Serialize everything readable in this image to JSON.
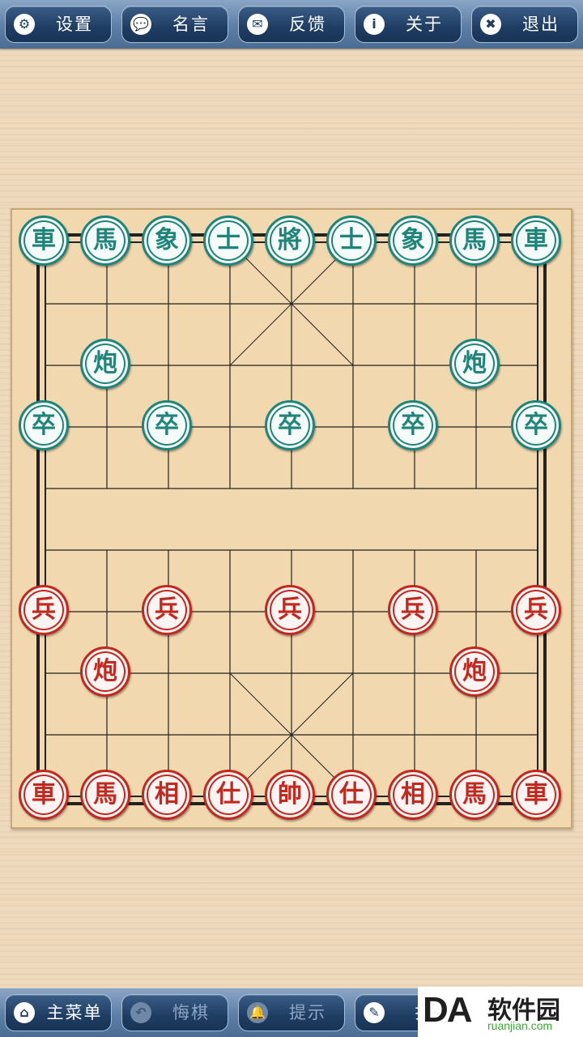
{
  "top_menu": [
    {
      "label": "设置",
      "icon": "gear-icon",
      "glyph": "⚙"
    },
    {
      "label": "名言",
      "icon": "speech-bubble-icon",
      "glyph": "💬"
    },
    {
      "label": "反馈",
      "icon": "envelope-icon",
      "glyph": "✉"
    },
    {
      "label": "关于",
      "icon": "info-icon",
      "glyph": "i"
    },
    {
      "label": "退出",
      "icon": "close-icon",
      "glyph": "✖"
    }
  ],
  "bottom_menu": [
    {
      "label": "主菜单",
      "icon": "home-icon",
      "glyph": "⌂",
      "disabled": false
    },
    {
      "label": "悔棋",
      "icon": "undo-icon",
      "glyph": "↶",
      "disabled": true
    },
    {
      "label": "提示",
      "icon": "bell-icon",
      "glyph": "🔔",
      "disabled": true
    },
    {
      "label": "提",
      "icon": "pencil-icon",
      "glyph": "✎",
      "disabled": false
    }
  ],
  "pieces": [
    {
      "char": "車",
      "side": "black",
      "col": 0,
      "row": 0
    },
    {
      "char": "馬",
      "side": "black",
      "col": 1,
      "row": 0
    },
    {
      "char": "象",
      "side": "black",
      "col": 2,
      "row": 0
    },
    {
      "char": "士",
      "side": "black",
      "col": 3,
      "row": 0
    },
    {
      "char": "將",
      "side": "black",
      "col": 4,
      "row": 0
    },
    {
      "char": "士",
      "side": "black",
      "col": 5,
      "row": 0
    },
    {
      "char": "象",
      "side": "black",
      "col": 6,
      "row": 0
    },
    {
      "char": "馬",
      "side": "black",
      "col": 7,
      "row": 0
    },
    {
      "char": "車",
      "side": "black",
      "col": 8,
      "row": 0
    },
    {
      "char": "炮",
      "side": "black",
      "col": 1,
      "row": 2
    },
    {
      "char": "炮",
      "side": "black",
      "col": 7,
      "row": 2
    },
    {
      "char": "卒",
      "side": "black",
      "col": 0,
      "row": 3
    },
    {
      "char": "卒",
      "side": "black",
      "col": 2,
      "row": 3
    },
    {
      "char": "卒",
      "side": "black",
      "col": 4,
      "row": 3
    },
    {
      "char": "卒",
      "side": "black",
      "col": 6,
      "row": 3
    },
    {
      "char": "卒",
      "side": "black",
      "col": 8,
      "row": 3
    },
    {
      "char": "兵",
      "side": "red",
      "col": 0,
      "row": 6
    },
    {
      "char": "兵",
      "side": "red",
      "col": 2,
      "row": 6
    },
    {
      "char": "兵",
      "side": "red",
      "col": 4,
      "row": 6
    },
    {
      "char": "兵",
      "side": "red",
      "col": 6,
      "row": 6
    },
    {
      "char": "兵",
      "side": "red",
      "col": 8,
      "row": 6
    },
    {
      "char": "炮",
      "side": "red",
      "col": 1,
      "row": 7
    },
    {
      "char": "炮",
      "side": "red",
      "col": 7,
      "row": 7
    },
    {
      "char": "車",
      "side": "red",
      "col": 0,
      "row": 9
    },
    {
      "char": "馬",
      "side": "red",
      "col": 1,
      "row": 9
    },
    {
      "char": "相",
      "side": "red",
      "col": 2,
      "row": 9
    },
    {
      "char": "仕",
      "side": "red",
      "col": 3,
      "row": 9
    },
    {
      "char": "帥",
      "side": "red",
      "col": 4,
      "row": 9
    },
    {
      "char": "仕",
      "side": "red",
      "col": 5,
      "row": 9
    },
    {
      "char": "相",
      "side": "red",
      "col": 6,
      "row": 9
    },
    {
      "char": "馬",
      "side": "red",
      "col": 7,
      "row": 9
    },
    {
      "char": "車",
      "side": "red",
      "col": 8,
      "row": 9
    }
  ],
  "colors": {
    "black_piece": "#1f857a",
    "red_piece": "#c3281e",
    "toolbar": "#5d7fa6",
    "board": "#f2d8ae"
  },
  "watermark": {
    "logo": "DA",
    "text": "软件园",
    "url": "ruanjian.com"
  }
}
